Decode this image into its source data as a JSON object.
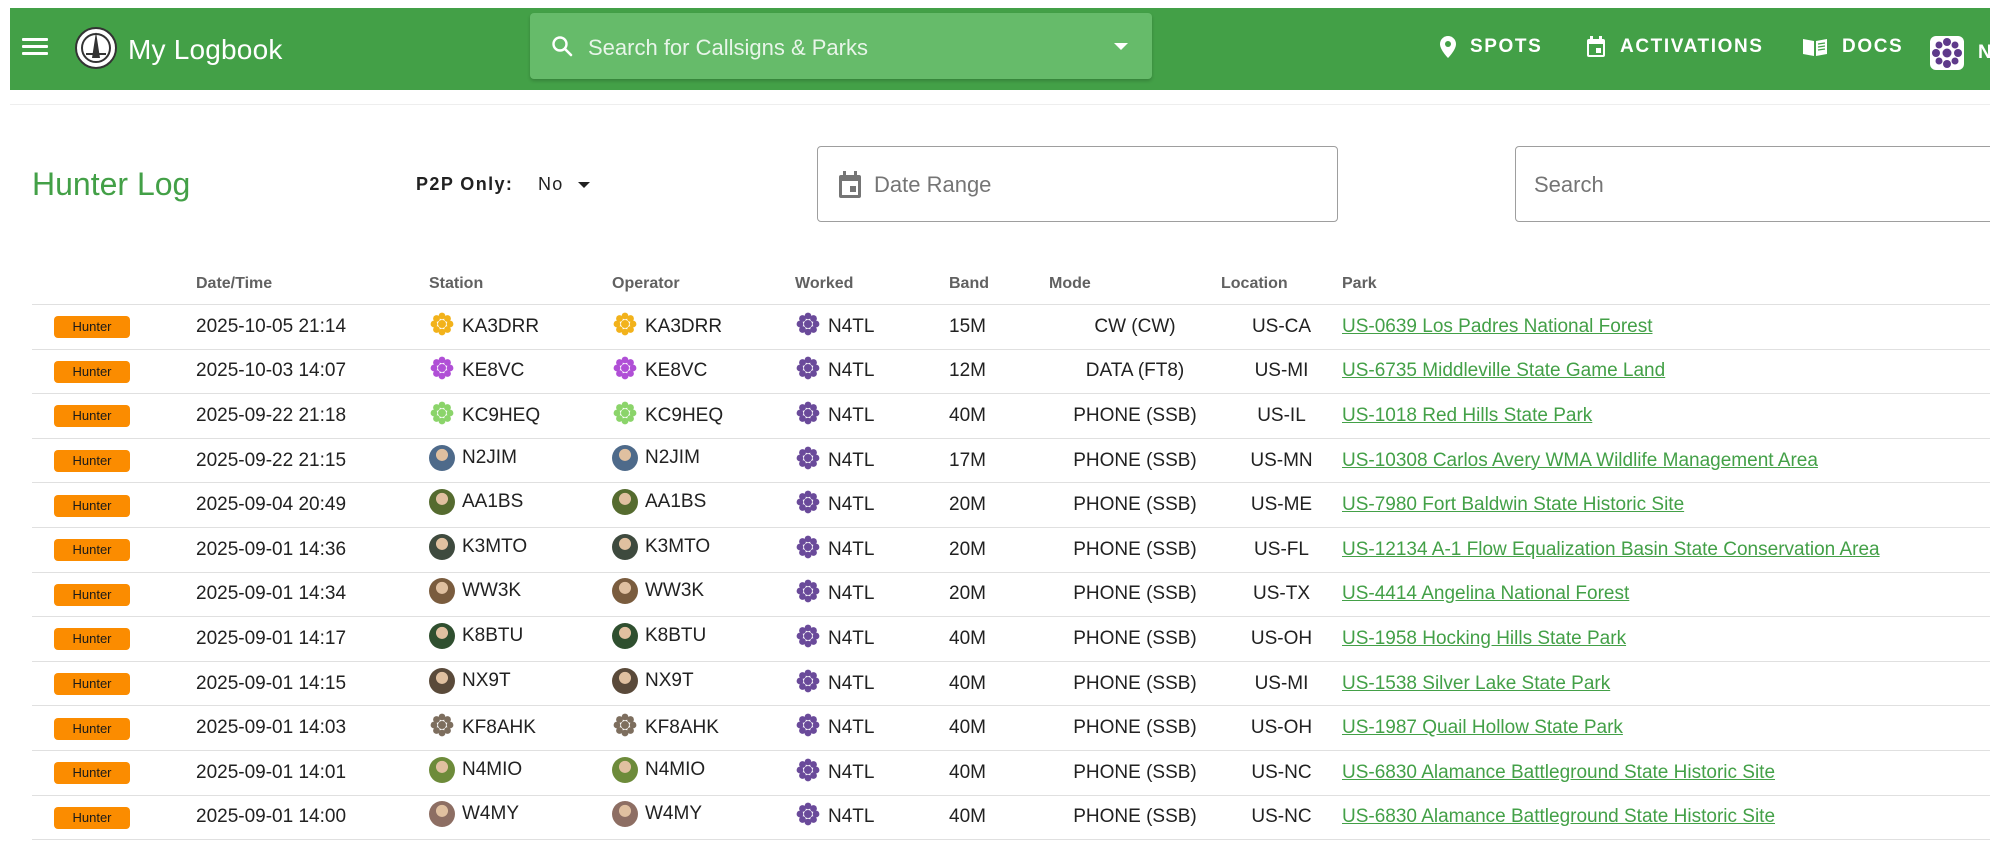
{
  "header": {
    "app_title": "My Logbook",
    "search_placeholder": "Search for Callsigns & Parks",
    "nav": [
      {
        "label": "SPOTS"
      },
      {
        "label": "ACTIVATIONS"
      },
      {
        "label": "DOCS"
      },
      {
        "label": "N"
      }
    ]
  },
  "page": {
    "title": "Hunter Log",
    "p2p_label": "P2P Only:",
    "p2p_value": "No",
    "date_range_placeholder": "Date Range",
    "search_placeholder": "Search"
  },
  "table": {
    "columns": [
      "",
      "Date/Time",
      "Station",
      "Operator",
      "Worked",
      "Band",
      "Mode",
      "Location",
      "Park"
    ],
    "rows": [
      {
        "badge": "Hunter",
        "datetime": "2025-10-05 21:14",
        "station": "KA3DRR",
        "operator": "KA3DRR",
        "worked": "N4TL",
        "band": "15M",
        "mode": "CW (CW)",
        "location": "US-CA",
        "park": "US-0639 Los Padres National Forest",
        "avatar": "flower-yellow"
      },
      {
        "badge": "Hunter",
        "datetime": "2025-10-03 14:07",
        "station": "KE8VC",
        "operator": "KE8VC",
        "worked": "N4TL",
        "band": "12M",
        "mode": "DATA (FT8)",
        "location": "US-MI",
        "park": "US-6735 Middleville State Game Land",
        "avatar": "flower-purple"
      },
      {
        "badge": "Hunter",
        "datetime": "2025-09-22 21:18",
        "station": "KC9HEQ",
        "operator": "KC9HEQ",
        "worked": "N4TL",
        "band": "40M",
        "mode": "PHONE (SSB)",
        "location": "US-IL",
        "park": "US-1018 Red Hills State Park",
        "avatar": "flower-green"
      },
      {
        "badge": "Hunter",
        "datetime": "2025-09-22 21:15",
        "station": "N2JIM",
        "operator": "N2JIM",
        "worked": "N4TL",
        "band": "17M",
        "mode": "PHONE (SSB)",
        "location": "US-MN",
        "park": "US-10308 Carlos Avery WMA Wildlife Management Area",
        "avatar": "photo"
      },
      {
        "badge": "Hunter",
        "datetime": "2025-09-04 20:49",
        "station": "AA1BS",
        "operator": "AA1BS",
        "worked": "N4TL",
        "band": "20M",
        "mode": "PHONE (SSB)",
        "location": "US-ME",
        "park": "US-7980 Fort Baldwin State Historic Site",
        "avatar": "photo"
      },
      {
        "badge": "Hunter",
        "datetime": "2025-09-01 14:36",
        "station": "K3MTO",
        "operator": "K3MTO",
        "worked": "N4TL",
        "band": "20M",
        "mode": "PHONE (SSB)",
        "location": "US-FL",
        "park": "US-12134 A-1 Flow Equalization Basin State Conservation Area",
        "avatar": "photo"
      },
      {
        "badge": "Hunter",
        "datetime": "2025-09-01 14:34",
        "station": "WW3K",
        "operator": "WW3K",
        "worked": "N4TL",
        "band": "20M",
        "mode": "PHONE (SSB)",
        "location": "US-TX",
        "park": "US-4414 Angelina National Forest",
        "avatar": "photo"
      },
      {
        "badge": "Hunter",
        "datetime": "2025-09-01 14:17",
        "station": "K8BTU",
        "operator": "K8BTU",
        "worked": "N4TL",
        "band": "40M",
        "mode": "PHONE (SSB)",
        "location": "US-OH",
        "park": "US-1958 Hocking Hills State Park",
        "avatar": "photo"
      },
      {
        "badge": "Hunter",
        "datetime": "2025-09-01 14:15",
        "station": "NX9T",
        "operator": "NX9T",
        "worked": "N4TL",
        "band": "40M",
        "mode": "PHONE (SSB)",
        "location": "US-MI",
        "park": "US-1538 Silver Lake State Park",
        "avatar": "photo"
      },
      {
        "badge": "Hunter",
        "datetime": "2025-09-01 14:03",
        "station": "KF8AHK",
        "operator": "KF8AHK",
        "worked": "N4TL",
        "band": "40M",
        "mode": "PHONE (SSB)",
        "location": "US-OH",
        "park": "US-1987 Quail Hollow State Park",
        "avatar": "flower-gray"
      },
      {
        "badge": "Hunter",
        "datetime": "2025-09-01 14:01",
        "station": "N4MIO",
        "operator": "N4MIO",
        "worked": "N4TL",
        "band": "40M",
        "mode": "PHONE (SSB)",
        "location": "US-NC",
        "park": "US-6830 Alamance Battleground State Historic Site",
        "avatar": "photo"
      },
      {
        "badge": "Hunter",
        "datetime": "2025-09-01 14:00",
        "station": "W4MY",
        "operator": "W4MY",
        "worked": "N4TL",
        "band": "40M",
        "mode": "PHONE (SSB)",
        "location": "US-NC",
        "park": "US-6830 Alamance Battleground State Historic Site",
        "avatar": "photo"
      }
    ]
  },
  "colors": {
    "brand_green": "#43a047",
    "search_green": "#66bb6a",
    "badge_orange": "#fb8c00",
    "link_green": "#43a047"
  }
}
